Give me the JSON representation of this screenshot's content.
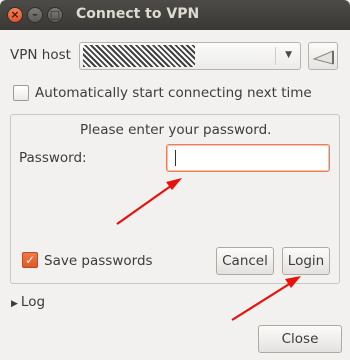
{
  "window": {
    "title": "Connect to VPN",
    "close_glyph": "×",
    "minimize_glyph": "–",
    "maximize_glyph": "□"
  },
  "host": {
    "label": "VPN host",
    "arrow_glyph": "▼"
  },
  "auto_connect": {
    "label": "Automatically start connecting next time",
    "checked": false
  },
  "password_panel": {
    "prompt": "Please enter your password.",
    "password_label": "Password:",
    "password_value": ""
  },
  "save_passwords": {
    "label": "Save passwords",
    "checked": true,
    "check_glyph": "✓"
  },
  "buttons": {
    "cancel": "Cancel",
    "login": "Login",
    "close": "Close"
  },
  "log": {
    "label": "Log",
    "expander_glyph": "▶"
  },
  "colors": {
    "accent": "#dd5a26",
    "annotation_arrow": "#e8110b",
    "titlebar": "#3c3b37"
  },
  "icons": {
    "vpn_button": "vpn-shield-icon"
  }
}
